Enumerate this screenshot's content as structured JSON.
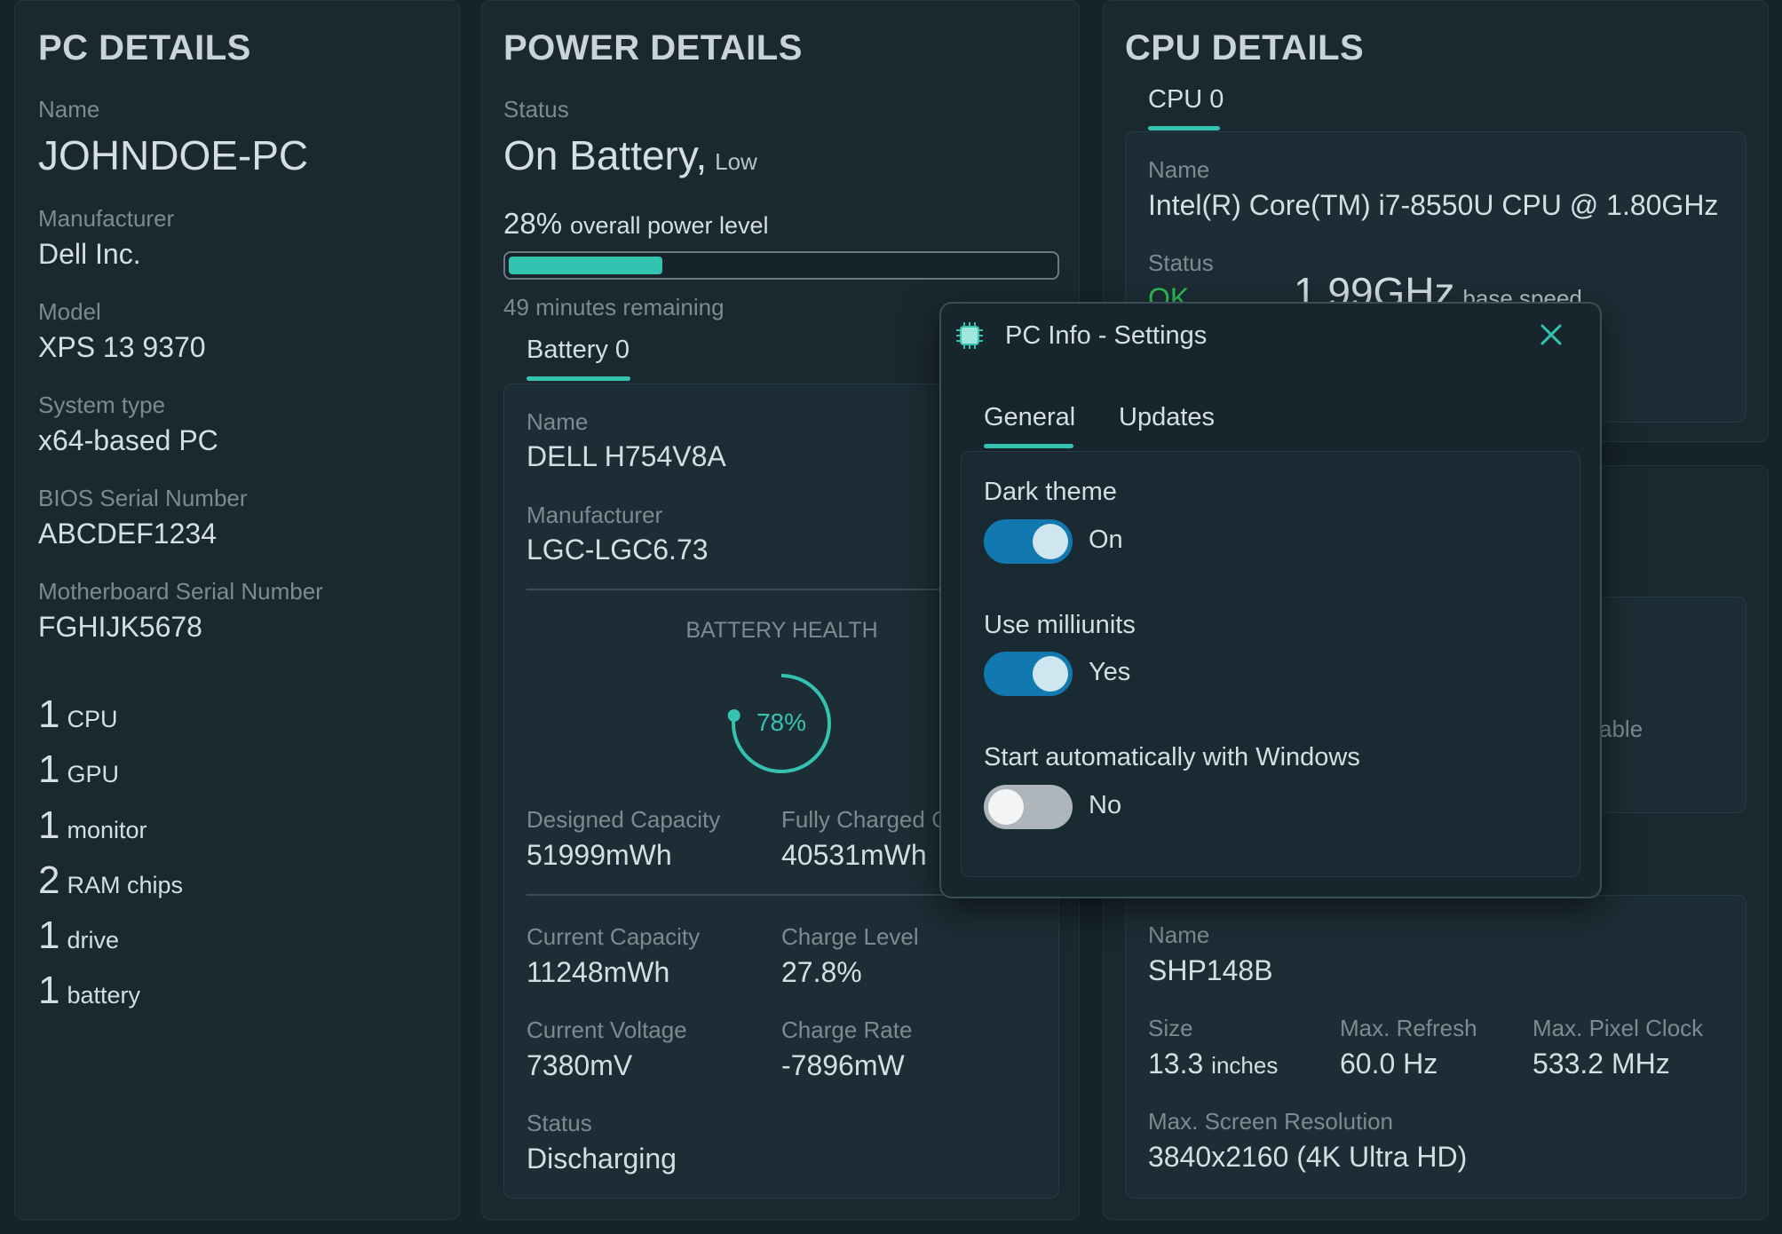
{
  "pc": {
    "title": "PC DETAILS",
    "fields": [
      {
        "label": "Name",
        "value": "JOHNDOE-PC"
      },
      {
        "label": "Manufacturer",
        "value": "Dell Inc."
      },
      {
        "label": "Model",
        "value": "XPS 13 9370"
      },
      {
        "label": "System type",
        "value": "x64-based PC"
      },
      {
        "label": "BIOS Serial Number",
        "value": "ABCDEF1234"
      },
      {
        "label": "Motherboard Serial Number",
        "value": "FGHIJK5678"
      }
    ],
    "counts": [
      {
        "num": "1",
        "unit": "CPU"
      },
      {
        "num": "1",
        "unit": "GPU"
      },
      {
        "num": "1",
        "unit": "monitor"
      },
      {
        "num": "2",
        "unit": "RAM chips"
      },
      {
        "num": "1",
        "unit": "drive"
      },
      {
        "num": "1",
        "unit": "battery"
      }
    ]
  },
  "power": {
    "title": "POWER DETAILS",
    "status_label": "Status",
    "status_value": "On Battery,",
    "status_sub": "Low",
    "level_percent": "28%",
    "level_text": "overall power level",
    "level_fraction": 0.28,
    "remaining": "49 minutes remaining",
    "tab": "Battery 0",
    "name_label": "Name",
    "name_value": "DELL H754V8A",
    "manufacturer_label": "Manufacturer",
    "manufacturer_value": "LGC-LGC6.73",
    "health_label": "BATTERY HEALTH",
    "health_value": "78%",
    "health_fraction": 0.78,
    "designed_label": "Designed Capacity",
    "designed_value": "51999mWh",
    "full_label": "Fully Charged C",
    "full_value": "40531mWh",
    "current_cap_label": "Current Capacity",
    "current_cap_value": "11248mWh",
    "charge_level_label": "Charge Level",
    "charge_level_value": "27.8%",
    "voltage_label": "Current Voltage",
    "voltage_value": "7380mV",
    "rate_label": "Charge Rate",
    "rate_value": "-7896mW",
    "bstatus_label": "Status",
    "bstatus_value": "Discharging"
  },
  "cpu": {
    "title": "CPU DETAILS",
    "tab": "CPU 0",
    "name_label": "Name",
    "name_value": "Intel(R) Core(TM) i7-8550U CPU @ 1.80GHz",
    "status_label": "Status",
    "status_value": "OK",
    "speed_value": "1.99GHz",
    "speed_sub": "base speed",
    "partial_text": "able"
  },
  "monitor": {
    "name_label": "Name",
    "name_value": "SHP148B",
    "size_label": "Size",
    "size_value": "13.3",
    "size_unit": "inches",
    "refresh_label": "Max. Refresh",
    "refresh_value": "60.0 Hz",
    "pixel_label": "Max. Pixel Clock",
    "pixel_value": "533.2 MHz",
    "res_label": "Max. Screen Resolution",
    "res_value": "3840x2160 (4K Ultra HD)"
  },
  "settings": {
    "title": "PC Info - Settings",
    "tabs": [
      "General",
      "Updates"
    ],
    "dark_theme_label": "Dark theme",
    "dark_theme_state": "On",
    "milliunits_label": "Use milliunits",
    "milliunits_state": "Yes",
    "autostart_label": "Start automatically with Windows",
    "autostart_state": "No"
  },
  "colors": {
    "accent": "#34c3b1",
    "toggle_on": "#1279b0",
    "ok_green": "#2fbf55"
  }
}
